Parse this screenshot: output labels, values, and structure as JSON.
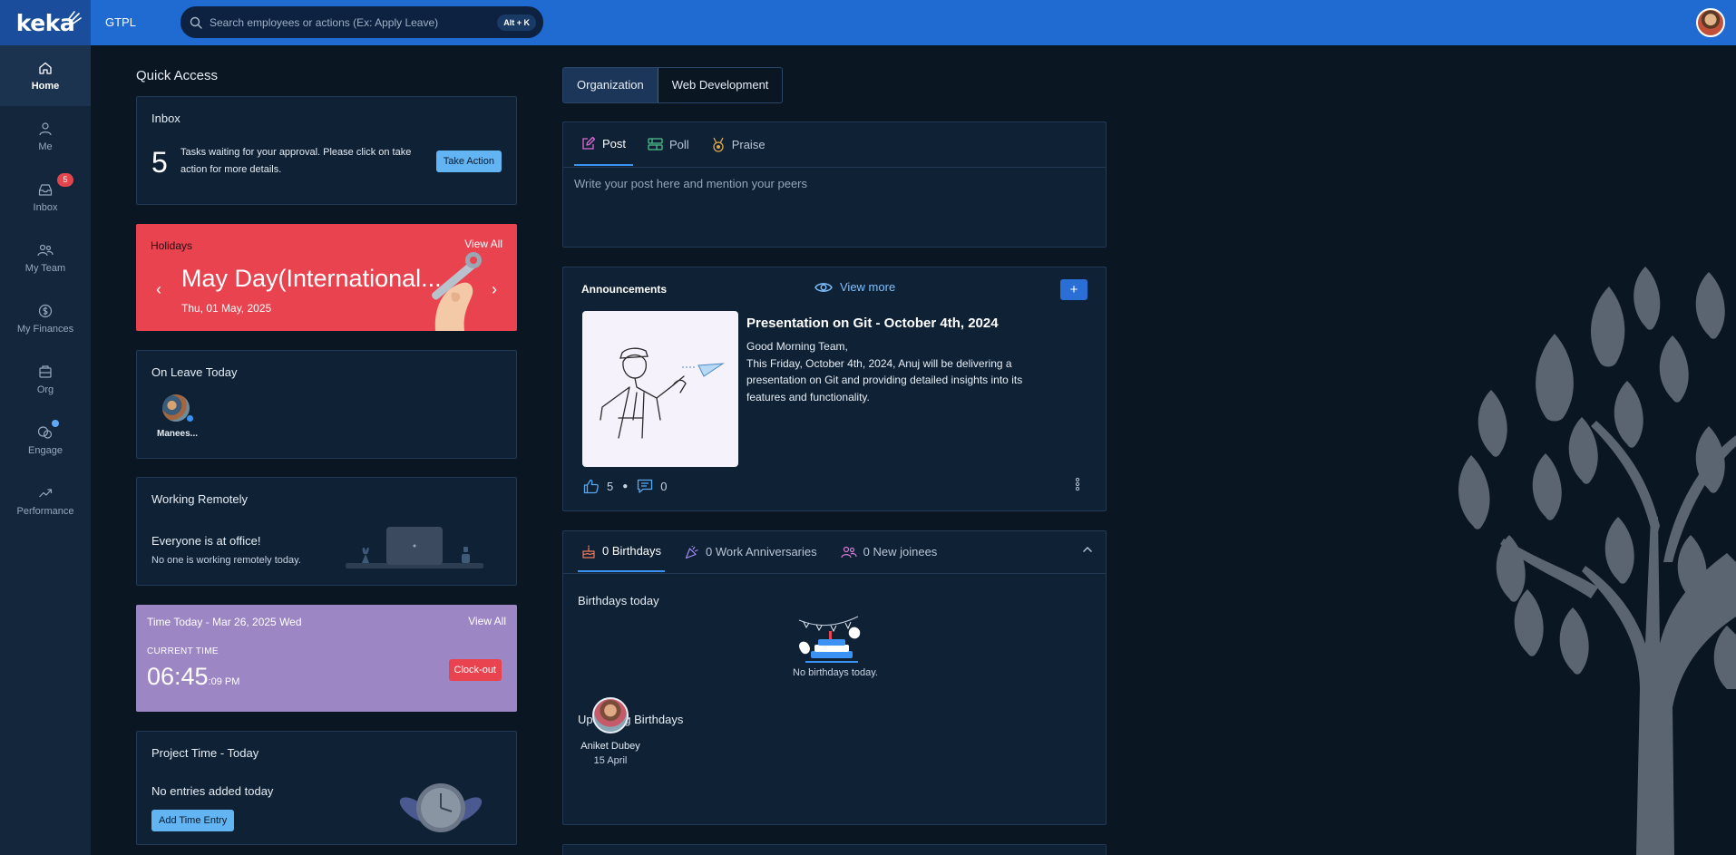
{
  "app": {
    "logo": "keka",
    "org": "GTPL"
  },
  "search": {
    "placeholder": "Search employees or actions (Ex: Apply Leave)",
    "shortcut": "Alt + K"
  },
  "sidebar": {
    "items": [
      {
        "label": "Home",
        "icon": "home-icon"
      },
      {
        "label": "Me",
        "icon": "person-icon"
      },
      {
        "label": "Inbox",
        "icon": "inbox-icon",
        "badge": "5"
      },
      {
        "label": "My Team",
        "icon": "team-icon"
      },
      {
        "label": "My Finances",
        "icon": "finances-icon"
      },
      {
        "label": "Org",
        "icon": "org-icon"
      },
      {
        "label": "Engage",
        "icon": "engage-icon"
      },
      {
        "label": "Performance",
        "icon": "performance-icon"
      }
    ]
  },
  "quick_access": {
    "title": "Quick Access",
    "inbox": {
      "title": "Inbox",
      "count": "5",
      "text": "Tasks waiting for your approval. Please click on take action for more details.",
      "button": "Take Action"
    },
    "holidays": {
      "title": "Holidays",
      "view_all": "View All",
      "name": "May Day(International...",
      "date": "Thu, 01 May, 2025"
    },
    "on_leave": {
      "title": "On Leave Today",
      "person": "Manees..."
    },
    "remote": {
      "title": "Working Remotely",
      "main": "Everyone is at office!",
      "sub": "No one is working remotely today."
    },
    "time_today": {
      "title": "Time Today - Mar 26, 2025 Wed",
      "view_all": "View All",
      "label": "CURRENT TIME",
      "time": "06:45",
      "suffix": ":09 PM",
      "button": "Clock-out"
    },
    "project_time": {
      "title": "Project Time - Today",
      "empty": "No entries added today",
      "button": "Add Time Entry"
    }
  },
  "feed": {
    "tabs": [
      "Organization",
      "Web Development"
    ],
    "composer": {
      "tabs": [
        "Post",
        "Poll",
        "Praise"
      ],
      "placeholder": "Write your post here and mention your peers"
    },
    "announcements": {
      "title": "Announcements",
      "view_more": "View more",
      "add": "+",
      "headline": "Presentation on Git - October 4th, 2024",
      "body": "Good Morning Team,\nThis Friday, October 4th, 2024, Anuj will be delivering a presentation on Git and providing detailed insights into its features and functionality.",
      "likes": "5",
      "comments": "0"
    },
    "celebrations": {
      "tabs": [
        "0 Birthdays",
        "0 Work Anniversaries",
        "0 New joinees"
      ],
      "today_title": "Birthdays today",
      "empty": "No birthdays today.",
      "upcoming_title": "Upcoming Birthdays",
      "upcoming": {
        "name": "Aniket Dubey",
        "date": "15 April"
      }
    }
  },
  "colors": {
    "topbar": "#1f6bd1",
    "sidebar": "#14263b",
    "background": "#0b1623",
    "holiday": "#e8434f",
    "time_card": "#9c86c4",
    "accent": "#3b92f3"
  }
}
